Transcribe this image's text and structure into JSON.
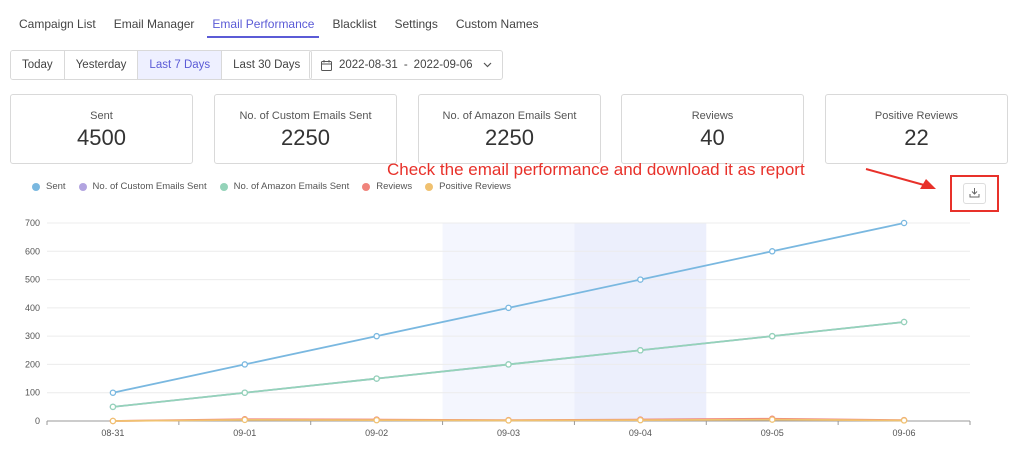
{
  "tabs": [
    {
      "label": "Campaign List"
    },
    {
      "label": "Email Manager"
    },
    {
      "label": "Email Performance",
      "active": true
    },
    {
      "label": "Blacklist"
    },
    {
      "label": "Settings"
    },
    {
      "label": "Custom Names"
    }
  ],
  "range_buttons": [
    {
      "label": "Today"
    },
    {
      "label": "Yesterday"
    },
    {
      "label": "Last 7 Days",
      "active": true
    },
    {
      "label": "Last 30 Days"
    }
  ],
  "date_range": {
    "start": "2022-08-31",
    "separator": "-",
    "end": "2022-09-06",
    "icon": "calendar-icon",
    "dropdown_icon": "chevron-down-icon"
  },
  "stats": [
    {
      "label": "Sent",
      "value": "4500"
    },
    {
      "label": "No. of Custom Emails Sent",
      "value": "2250"
    },
    {
      "label": "No. of Amazon Emails Sent",
      "value": "2250"
    },
    {
      "label": "Reviews",
      "value": "40"
    },
    {
      "label": "Positive Reviews",
      "value": "22"
    }
  ],
  "annotation": {
    "text": "Check the email performance and download it as report",
    "color": "#e8312a"
  },
  "download_button": {
    "icon": "download-icon"
  },
  "colors": {
    "accent": "#5b5bd6",
    "annotation": "#e8312a"
  },
  "chart_data": {
    "type": "line",
    "title": "",
    "xlabel": "",
    "ylabel": "",
    "x": [
      "08-31",
      "09-01",
      "09-02",
      "09-03",
      "09-04",
      "09-05",
      "09-06"
    ],
    "ylim": [
      0,
      700
    ],
    "yticks": [
      0,
      100,
      200,
      300,
      400,
      500,
      600,
      700
    ],
    "grid": true,
    "legend_position": "top-left",
    "highlighted_x": [
      "09-03",
      "09-04"
    ],
    "series": [
      {
        "name": "Sent",
        "color": "#7ab8e0",
        "values": [
          100,
          200,
          300,
          400,
          500,
          600,
          700
        ]
      },
      {
        "name": "No. of Custom Emails Sent",
        "color": "#b2a4e0",
        "values": [
          50,
          100,
          150,
          200,
          250,
          300,
          350
        ]
      },
      {
        "name": "No. of Amazon Emails Sent",
        "color": "#94d3b9",
        "values": [
          50,
          100,
          150,
          200,
          250,
          300,
          350
        ]
      },
      {
        "name": "Reviews",
        "color": "#f0847c",
        "values": [
          0,
          6,
          5,
          3,
          5,
          8,
          3
        ]
      },
      {
        "name": "Positive Reviews",
        "color": "#f0c170",
        "values": [
          0,
          4,
          3,
          2,
          3,
          5,
          2
        ]
      }
    ]
  }
}
